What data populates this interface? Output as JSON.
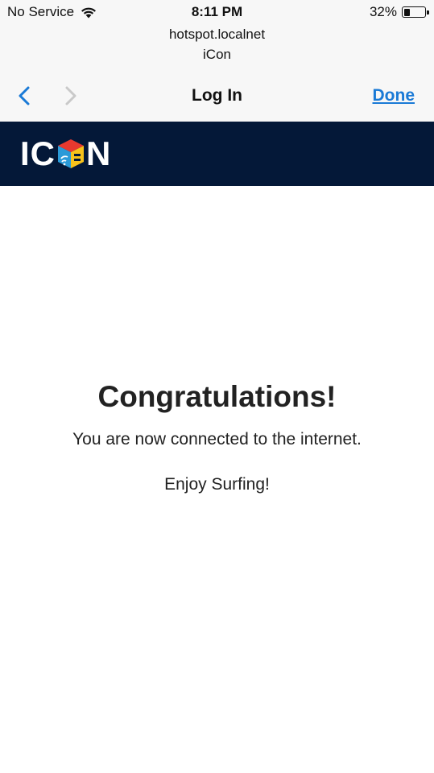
{
  "status_bar": {
    "carrier": "No Service",
    "time": "8:11 PM",
    "battery_percent": "32%",
    "battery_level": 0.32,
    "icons": [
      "wifi-icon",
      "battery-icon"
    ]
  },
  "browser": {
    "url": "hotspot.localnet",
    "site_name": "iCon",
    "title": "Log In",
    "done_label": "Done",
    "icons": [
      "back-arrow-icon",
      "forward-arrow-icon"
    ]
  },
  "brand": {
    "logo_letters": [
      "I",
      "C",
      "N"
    ],
    "banner_color": "#041838",
    "cube_colors": [
      "#e8392f",
      "#f7c21b",
      "#2a9ad8"
    ]
  },
  "main": {
    "headline": "Congratulations!",
    "message": "You are now connected to the internet.",
    "tagline": "Enjoy Surfing!"
  },
  "colors": {
    "accent": "#1a7ad6",
    "text": "#222222",
    "header_bg": "#f7f7f7"
  }
}
